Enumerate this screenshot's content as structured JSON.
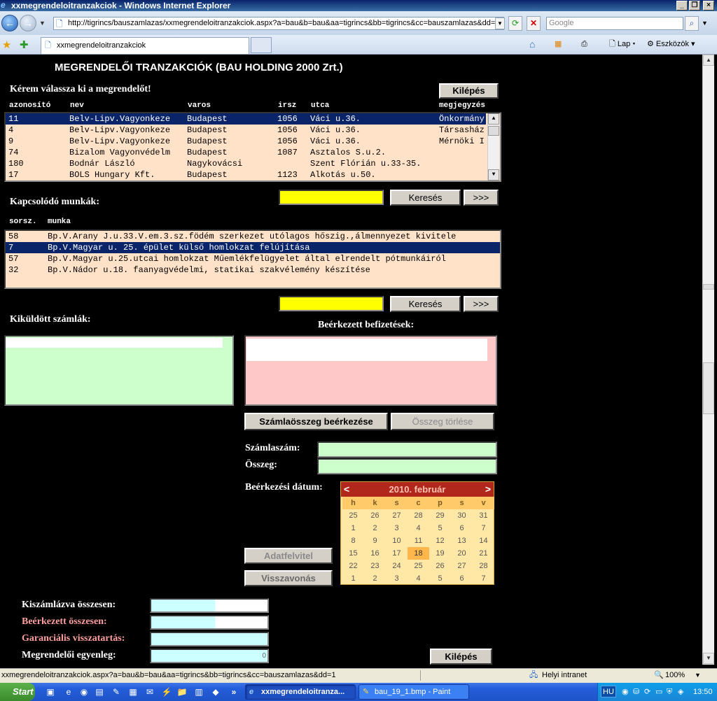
{
  "window": {
    "title": "xxmegrendeloitranzakciok - Windows Internet Explorer"
  },
  "browser": {
    "url": "http://tigrincs/bauszamlazas/xxmegrendeloitranzakciok.aspx?a=bau&b=bau&aa=tigrincs&bb=tigrincs&cc=bauszamlazas&dd=",
    "search_placeholder": "Google",
    "tab_title": "xxmegrendeloitranzakciok",
    "toolbar": {
      "page": "Lap",
      "tools": "Eszközök"
    }
  },
  "page": {
    "title": "MEGRENDELŐI TRANZAKCIÓK (BAU HOLDING 2000 Zrt.)",
    "choose_label": "Kérem válassza ki a megrendelőt!",
    "exit_label": "Kilépés",
    "customers": {
      "columns": [
        "azonosító",
        "nev",
        "varos",
        "irsz",
        "utca",
        "megjegyzés"
      ],
      "rows": [
        [
          "11",
          "Belv-Lipv.Vagyonkeze",
          "Budapest",
          "1056",
          "Váci u.36.",
          "Önkormány"
        ],
        [
          "4",
          "Belv-Lipv.Vagyonkeze",
          "Budapest",
          "1056",
          "Váci u.36.",
          "Társasház"
        ],
        [
          "9",
          "Belv-Lipv.Vagyonkeze",
          "Budapest",
          "1056",
          "Váci u.36.",
          "Mérnöki I"
        ],
        [
          "74",
          "Bizalom Vagyonvédelm",
          "Budapest",
          "1087",
          "Asztalos S.u.2.",
          ""
        ],
        [
          "180",
          "Bodnár László",
          "Nagykovácsi",
          "",
          "Szent Flórián u.33-35.",
          ""
        ],
        [
          "17",
          "BOLS Hungary Kft.",
          "Budapest",
          "1123",
          "Alkotás u.50.",
          ""
        ]
      ]
    },
    "search_label": "Keresés",
    "next_label": ">>>",
    "jobs_label": "Kapcsolódó munkák:",
    "jobs": {
      "columns": [
        "sorsz.",
        "munka"
      ],
      "rows": [
        [
          "58",
          "Bp.V.Arany J.u.33.V.em.3.sz.födém szerkezet utólagos hőszig.,álmennyezet kivitele"
        ],
        [
          "7",
          "Bp.V.Magyar u. 25. épület külső homlokzat felújítása"
        ],
        [
          "57",
          "Bp.V.Magyar u.25.utcai homlokzat Műemlékfelügyelet által elrendelt pótmunkáiról"
        ],
        [
          "32",
          "Bp.V.Nádor u.18. faanyagvédelmi, statikai szakvélemény készítése"
        ]
      ]
    },
    "invoices_label": "Kiküldött számlák:",
    "payments_label": "Beérkezett befizetések:",
    "btn_receive": "Számlaösszeg beérkezése",
    "btn_delete": "Összeg törlése",
    "invoice_no_label": "Számlaszám:",
    "amount_label": "Összeg:",
    "date_label": "Beérkezési dátum:",
    "btn_save": "Adatfelvitel",
    "btn_cancel": "Visszavonás",
    "calendar": {
      "title": "2010. február",
      "prev": "<",
      "next": ">",
      "weekdays": [
        "h",
        "k",
        "s",
        "c",
        "p",
        "s",
        "v"
      ],
      "weeks": [
        [
          "25",
          "26",
          "27",
          "28",
          "29",
          "30",
          "31"
        ],
        [
          "1",
          "2",
          "3",
          "4",
          "5",
          "6",
          "7"
        ],
        [
          "8",
          "9",
          "10",
          "11",
          "12",
          "13",
          "14"
        ],
        [
          "15",
          "16",
          "17",
          "18",
          "19",
          "20",
          "21"
        ],
        [
          "22",
          "23",
          "24",
          "25",
          "26",
          "27",
          "28"
        ],
        [
          "1",
          "2",
          "3",
          "4",
          "5",
          "6",
          "7"
        ]
      ],
      "today": "18"
    },
    "totals": {
      "invoiced_label": "Kiszámlázva összesen:",
      "received_label": "Beérkezett összesen:",
      "guarantee_label": "Garanciális visszatartás:",
      "balance_label": "Megrendelői egyenleg:",
      "balance_value": "0"
    }
  },
  "statusbar": {
    "url": "xxmegrendeloitranzakciok.aspx?a=bau&b=bau&aa=tigrincs&bb=tigrincs&cc=bauszamlazas&dd=1",
    "zone": "Helyi intranet",
    "zoom": "100%"
  },
  "taskbar": {
    "start": "Start",
    "task1": "xxmegrendeloitranza...",
    "task2": "bau_19_1.bmp - Paint",
    "lang": "HU",
    "time": "13:50"
  }
}
